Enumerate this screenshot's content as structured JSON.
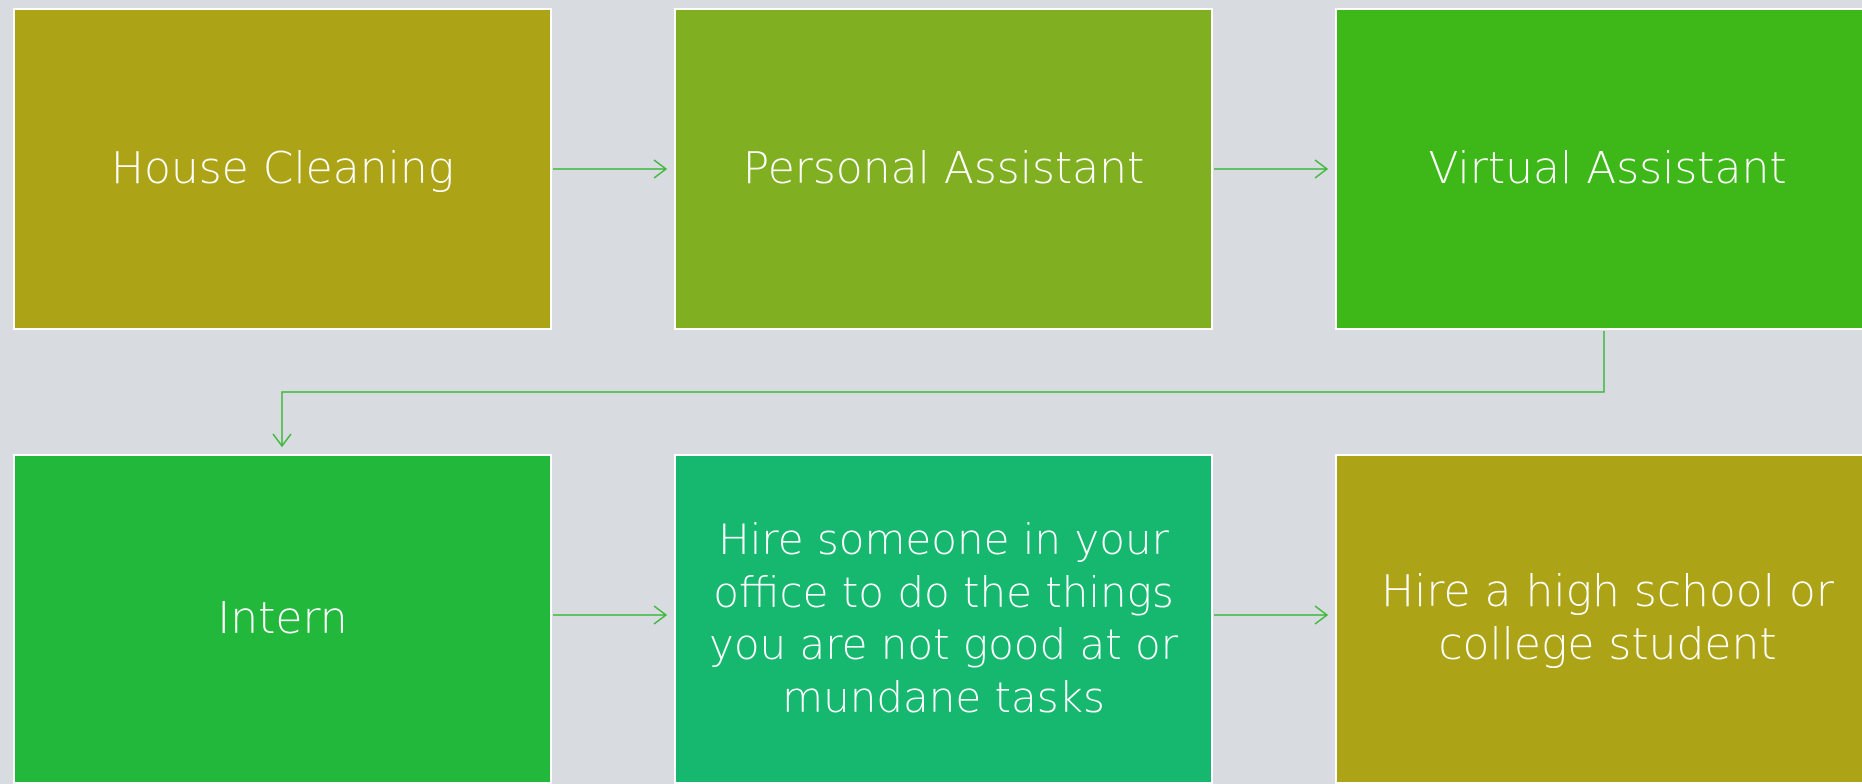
{
  "colors": {
    "background": "#d8dbe0",
    "box_border": "#ffffff",
    "text": "#ffffff",
    "olive": "#ada316",
    "lime": "#80b021",
    "green": "#3eb818",
    "bright_green": "#22b83c",
    "teal": "#15b86e",
    "connector": "#3eb83c"
  },
  "diagram": {
    "nodes": [
      {
        "id": "n1",
        "label": "House Cleaning",
        "color": "#ada316"
      },
      {
        "id": "n2",
        "label": "Personal Assistant",
        "color": "#80b021"
      },
      {
        "id": "n3",
        "label": "Virtual Assistant",
        "color": "#3eb818"
      },
      {
        "id": "n4",
        "label": "Intern",
        "color": "#22b83c"
      },
      {
        "id": "n5",
        "label": "Hire someone in your office to do the things you are not good at or mundane tasks",
        "color": "#15b86e"
      },
      {
        "id": "n6",
        "label": "Hire a high school or college student",
        "color": "#ada316"
      }
    ],
    "edges": [
      {
        "from": "n1",
        "to": "n2"
      },
      {
        "from": "n2",
        "to": "n3"
      },
      {
        "from": "n3",
        "to": "n4"
      },
      {
        "from": "n4",
        "to": "n5"
      },
      {
        "from": "n5",
        "to": "n6"
      }
    ]
  }
}
